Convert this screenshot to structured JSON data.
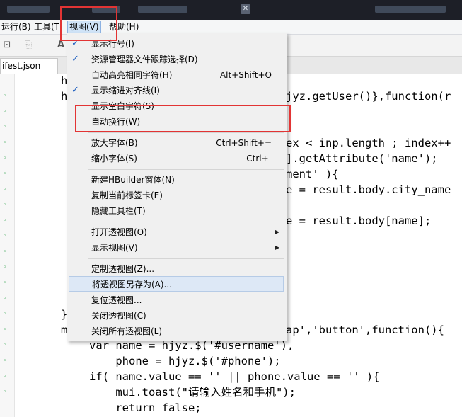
{
  "menubar": {
    "items": [
      {
        "label": "运行(B)"
      },
      {
        "label": "工具(T)"
      },
      {
        "label": "视图(V)"
      },
      {
        "label": "帮助(H)"
      }
    ]
  },
  "tab": {
    "label": "ifest.json"
  },
  "code": {
    "lines_right": [
      {
        "text": ""
      },
      {
        "text": "jyz.getUser()},function(r"
      },
      {
        "text": ""
      },
      {
        "text": ""
      },
      {
        "text": "ex < inp.length ; index++"
      },
      {
        "text": "].getAttribute('name');"
      },
      {
        "text": "ment' ){"
      },
      {
        "text": "e = result.body.city_name"
      },
      {
        "text": ""
      },
      {
        "text": "e = result.body[name];"
      }
    ],
    "line_tap": "ap','button',function(){",
    "line_var": "var name = hjyz.$('#username'),",
    "line_phone": "    phone = hjyz.$('#phone');",
    "line_if": "if( name.value == '' || phone.value == '' ){",
    "line_toast": "    mui.toast(\"请输入姓名和手机\");",
    "line_return": "    return false;",
    "left_chars": [
      "h",
      "h",
      "}",
      "m"
    ]
  },
  "view_menu": {
    "items": [
      {
        "label": "显示行号(I)",
        "checked": true
      },
      {
        "label": "资源管理器文件跟踪选择(D)",
        "checked": true
      },
      {
        "label": "自动高亮相同字符(H)",
        "shortcut": "Alt+Shift+O"
      },
      {
        "label": "显示缩进对齐线(I)",
        "checked": true
      },
      {
        "label": "显示空白字符(S)"
      },
      {
        "label": "自动换行(W)"
      },
      {
        "label": "放大字体(B)",
        "shortcut": "Ctrl+Shift+="
      },
      {
        "label": "缩小字体(S)",
        "shortcut": "Ctrl+-"
      },
      {
        "label": "新建HBuilder窗体(N)"
      },
      {
        "label": "复制当前标签卡(E)"
      },
      {
        "label": "隐藏工具栏(T)"
      },
      {
        "label": "打开透视图(O)",
        "submenu": true
      },
      {
        "label": "显示视图(V)",
        "submenu": true
      },
      {
        "label": "定制透视图(Z)..."
      },
      {
        "label": "将透视图另存为(A)...",
        "highlighted": true
      },
      {
        "label": "复位透视图..."
      },
      {
        "label": "关闭透视图(C)"
      },
      {
        "label": "关闭所有透视图(L)"
      }
    ]
  },
  "colors": {
    "highlight_box": "#e23434",
    "keyword": "#7f0055",
    "string": "#2a7f9e",
    "check": "#2060c0"
  },
  "icons": {
    "check": "check-icon",
    "submenu": "submenu-arrow-icon",
    "fold": "fold-marker-icon"
  }
}
